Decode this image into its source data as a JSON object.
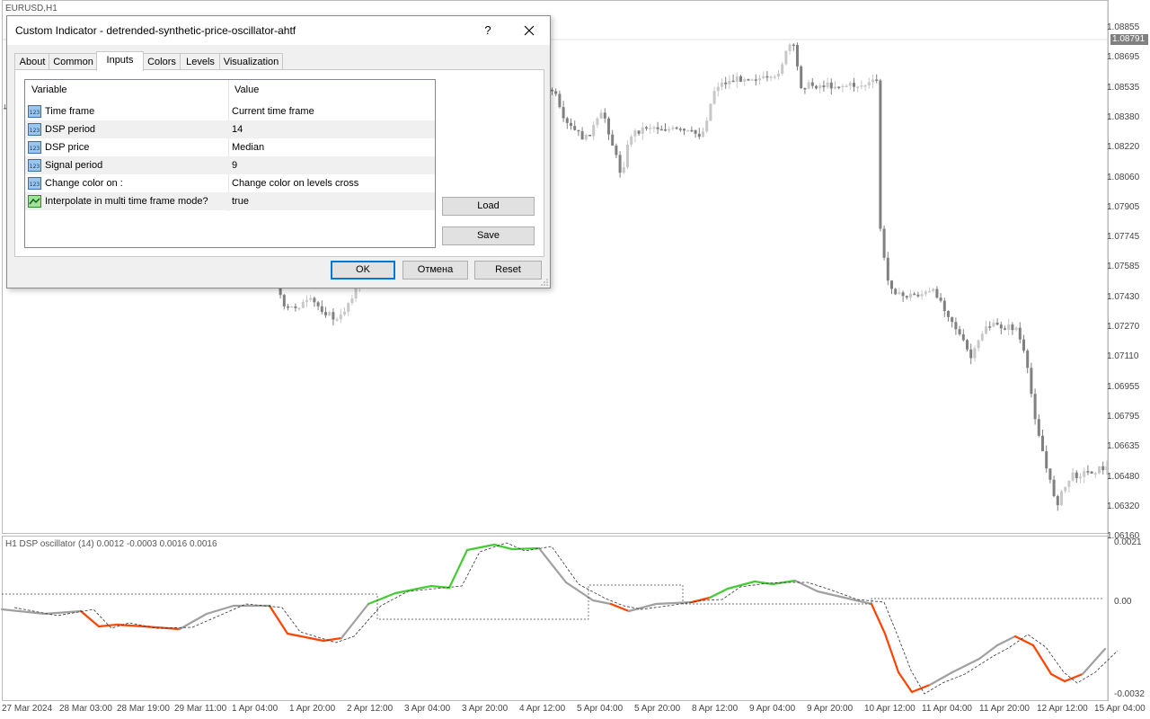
{
  "chart": {
    "symbol_label": "EURUSD,H1",
    "price_scale": [
      "1.08855",
      "1.08695",
      "1.08535",
      "1.08380",
      "1.08220",
      "1.08060",
      "1.07905",
      "1.07745",
      "1.07585",
      "1.07430",
      "1.07270",
      "1.07110",
      "1.06955",
      "1.06795",
      "1.06635",
      "1.06480",
      "1.06320",
      "1.06160"
    ],
    "current_price": "1.08791",
    "indicator_label": "H1 DSP oscillator (14) 0.0012 -0.0003 0.0016 0.0016",
    "osc_scale": [
      "0.0021",
      "0.00",
      "-0.0032"
    ],
    "dates": [
      "27 Mar 2024",
      "28 Mar 03:00",
      "28 Mar 19:00",
      "29 Mar 11:00",
      "1 Apr 04:00",
      "1 Apr 20:00",
      "2 Apr 12:00",
      "3 Apr 04:00",
      "3 Apr 20:00",
      "4 Apr 12:00",
      "5 Apr 04:00",
      "5 Apr 20:00",
      "8 Apr 12:00",
      "9 Apr 04:00",
      "9 Apr 20:00",
      "10 Apr 12:00",
      "11 Apr 04:00",
      "11 Apr 20:00",
      "12 Apr 12:00",
      "15 Apr 04:00"
    ],
    "colors": {
      "up": "#c8c8c8",
      "down": "#808080",
      "osc_up": "#44cc33",
      "osc_down": "#ff4400",
      "osc_neutral": "#a0a0a0"
    }
  },
  "dialog": {
    "title": "Custom Indicator - detrended-synthetic-price-oscillator-ahtf",
    "help_label": "?",
    "close_icon": "close-icon",
    "tabs": [
      "About",
      "Common",
      "Inputs",
      "Colors",
      "Levels",
      "Visualization"
    ],
    "active_tab": "Inputs",
    "table": {
      "col_variable": "Variable",
      "col_value": "Value",
      "rows": [
        {
          "variable": "Time frame",
          "value": "Current time frame",
          "icon": "number-param-icon"
        },
        {
          "variable": "DSP period",
          "value": "14",
          "icon": "number-param-icon"
        },
        {
          "variable": "DSP price",
          "value": "Median",
          "icon": "number-param-icon"
        },
        {
          "variable": "Signal period",
          "value": "9",
          "icon": "number-param-icon"
        },
        {
          "variable": "Change color on :",
          "value": "Change color on levels cross",
          "icon": "number-param-icon"
        },
        {
          "variable": "Interpolate in multi time frame mode?",
          "value": "true",
          "icon": "bool-param-icon"
        }
      ]
    },
    "load_label": "Load",
    "save_label": "Save",
    "ok_label": "OK",
    "cancel_label": "Отмена",
    "reset_label": "Reset"
  }
}
